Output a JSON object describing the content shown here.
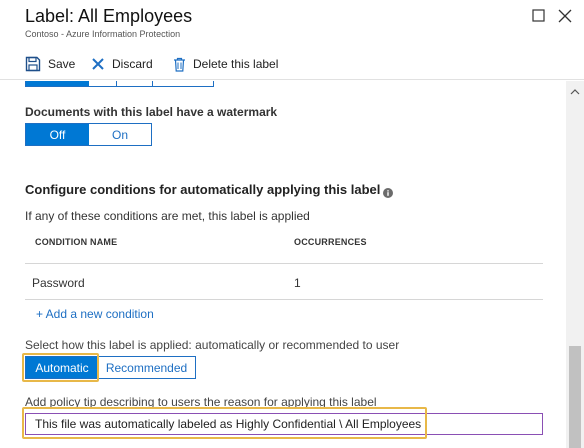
{
  "header": {
    "title": "Label: All Employees",
    "subtitle": "Contoso - Azure Information Protection",
    "maximize_icon": "maximize-icon",
    "close_icon": "close-icon"
  },
  "toolbar": {
    "save_label": "Save",
    "discard_label": "Discard",
    "delete_label": "Delete this label"
  },
  "watermark": {
    "label": "Documents with this label have a watermark",
    "options": [
      "Off",
      "On"
    ],
    "selected": "Off"
  },
  "conditions": {
    "title": "Configure conditions for automatically applying this label",
    "description": "If any of these conditions are met, this label is applied",
    "columns": [
      "CONDITION NAME",
      "OCCURRENCES"
    ],
    "rows": [
      {
        "name": "Password",
        "occurrences": "1"
      }
    ],
    "add_link": "+ Add a new condition"
  },
  "apply_mode": {
    "label": "Select how this label is applied: automatically or recommended to user",
    "options": [
      "Automatic",
      "Recommended"
    ],
    "selected": "Automatic"
  },
  "policy_tip": {
    "label": "Add policy tip describing to users the reason for applying this label",
    "value": "This file was automatically labeled as Highly Confidential \\ All Employees"
  },
  "colors": {
    "accent": "#0078d4",
    "highlight": "#e8b848",
    "input_border": "#8a4fb4"
  }
}
